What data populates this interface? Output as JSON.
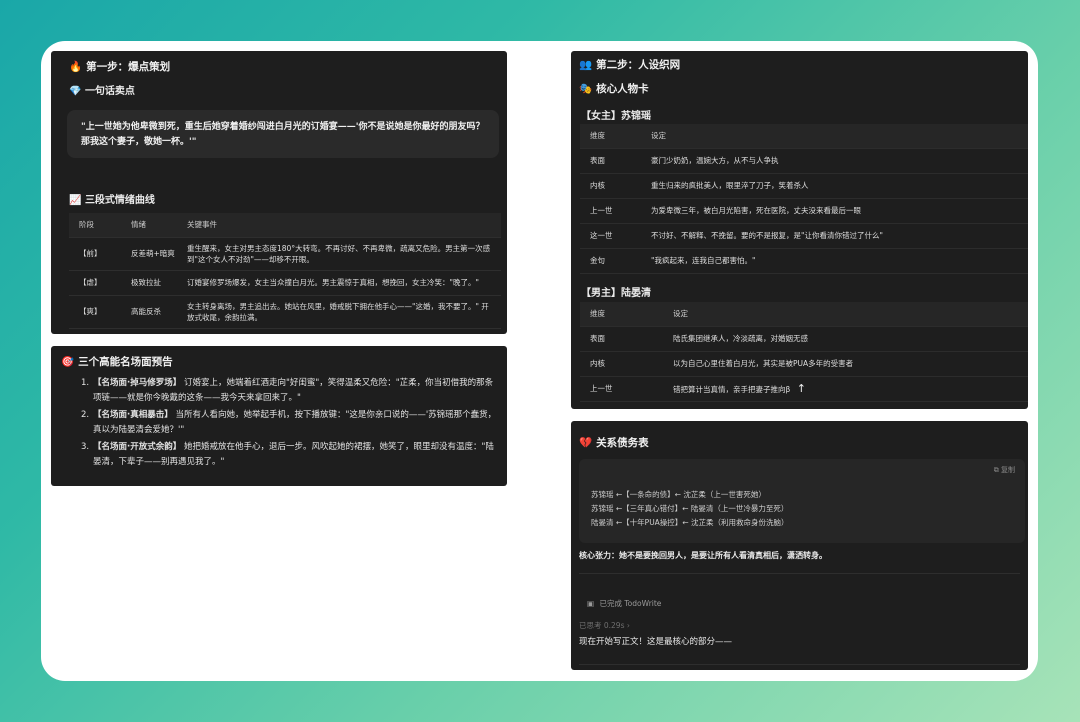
{
  "left_panel_1": {
    "title_icon": "🔥",
    "title": "第一步：爆点策划",
    "oneliner_icon": "💎",
    "oneliner_title": "一句话卖点",
    "oneliner_quote": "\"上一世她为他卑微到死，重生后她穿着婚纱闯进白月光的订婚宴——'你不是说她是你最好的朋友吗？那我这个妻子，敬她一杯。'\"",
    "curve_icon": "📈",
    "curve_title": "三段式情绪曲线",
    "curve_table": {
      "headers": [
        "阶段",
        "情绪",
        "关键事件"
      ],
      "rows": [
        [
          "【前】",
          "反差萌+暗爽",
          "重生醒来，女主对男主态度180°大转弯。不再讨好、不再卑微，疏离又危险。男主第一次感到\"这个女人不对劲\"——却移不开眼。"
        ],
        [
          "【虐】",
          "极致拉扯",
          "订婚宴修罗场爆发，女主当众撞白月光。男主震惊于真相，想挽回，女主冷笑：\"晚了。\""
        ],
        [
          "【爽】",
          "高能反杀",
          "女主转身离场，男主追出去。她站在风里，婚戒脱下拥在他手心——\"这婚，我不要了。\" 开放式收尾，余韵拉满。"
        ]
      ]
    }
  },
  "left_panel_2": {
    "title_icon": "🎯",
    "title": "三个高能名场面预告",
    "scenes": [
      {
        "num": "1.",
        "head": "【名场面·掉马修罗场】",
        "text": "订婚宴上，她端着红酒走向\"好闺蜜\"，笑得温柔又危险：\"芷柔，你当初借我的那条项链——就是你今晚戴的这条——我今天来拿回来了。\""
      },
      {
        "num": "2.",
        "head": "【名场面·真相暴击】",
        "text": "当所有人看向她，她举起手机，按下播放键：\"这是你亲口说的——'苏锦瑶那个蠢货，真以为陆晏清会爱她？'\""
      },
      {
        "num": "3.",
        "head": "【名场面·开放式余韵】",
        "text": "她把婚戒放在他手心，退后一步。风吹起她的裙摆，她笑了，眼里却没有温度：\"陆晏清，下辈子——别再遇见我了。\""
      }
    ]
  },
  "right_panel_1": {
    "title_icon": "👥",
    "title": "第二步：人设织网",
    "core_icon": "🎭",
    "core_title": "核心人物卡",
    "female_label": "【女主】苏锦瑶",
    "female_table": {
      "headers": [
        "维度",
        "设定"
      ],
      "rows": [
        [
          "表面",
          "豪门少奶奶，温婉大方，从不与人争执"
        ],
        [
          "内核",
          "重生归来的疯批美人，眼里淬了刀子，笑着杀人"
        ],
        [
          "上一世",
          "为爱卑微三年，被白月光陷害，死在医院，丈夫没来看最后一眼"
        ],
        [
          "这一世",
          "不讨好、不解释、不挽留。要的不是报复，是\"让你看清你错过了什么\""
        ],
        [
          "金句",
          "\"我疯起来，连我自己都害怕。\""
        ]
      ]
    },
    "male_label": "【男主】陆晏清",
    "male_table": {
      "headers": [
        "维度",
        "设定"
      ],
      "rows": [
        [
          "表面",
          "陆氏集团继承人，冷淡疏离，对婚姻无感"
        ],
        [
          "内核",
          "以为自己心里住着白月光，其实是被PUA多年的受害者"
        ],
        [
          "上一世",
          "错把算计当真情，亲手把妻子推向β"
        ]
      ]
    },
    "scroll_icon": "arrow-up-icon"
  },
  "right_panel_2": {
    "title_icon": "💔",
    "title": "关系债务表",
    "copy_label": "复制",
    "code_lines": [
      "苏锦瑶 ←【一条命的债】← 沈芷柔（上一世害死她）",
      "苏锦瑶 ←【三年真心错付】← 陆晏清（上一世冷暴力至死）",
      "陆晏清 ←【十年PUA操控】← 沈芷柔（利用救命身份洗脑）"
    ],
    "tension_label": "核心张力：",
    "tension_text": "她不是要挽回男人，是要让所有人看清真相后，潇洒转身。",
    "todo_text": "已完成 TodoWrite",
    "thinking_text": "已思考 0.29s",
    "final_text": "现在开始写正文！这是最核心的部分——"
  }
}
